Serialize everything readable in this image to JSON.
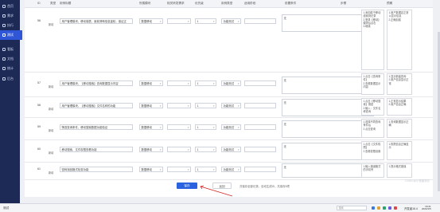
{
  "sidebar": {
    "items": [
      {
        "label": "首页",
        "icon": "home-icon",
        "active": false
      },
      {
        "label": "需求",
        "icon": "doc-icon",
        "active": false
      },
      {
        "label": "执行",
        "icon": "run-icon",
        "active": false
      },
      {
        "label": "测试",
        "icon": "test-icon",
        "active": true
      },
      {
        "label": "看板",
        "icon": "board-icon",
        "active": false
      },
      {
        "label": "文档",
        "icon": "file-icon",
        "active": false
      },
      {
        "label": "统计",
        "icon": "chart-icon",
        "active": false
      },
      {
        "label": "后台",
        "icon": "settings-icon",
        "active": false
      }
    ]
  },
  "table": {
    "headers": [
      "ID",
      "类型",
      "用例标题",
      "所属模块",
      "相关研发需求",
      "优先级",
      "用例类型",
      "适用阶段",
      "前置条件",
      "步骤",
      "预期"
    ],
    "rows": [
      {
        "id": "56",
        "status": "新增",
        "title": "用户管理模块，移动端表，面前清晰信息量较，保证正",
        "module": "数据移动",
        "priority": "1",
        "case_type": "功能测试",
        "stage": "",
        "pre": "无",
        "steps": [
          {
            "n": "1.",
            "text": "添加若干移动线索到记录"
          },
          {
            "n": "2.",
            "text": "登录【移动】模块后点击"
          },
          {
            "n": "3.",
            "text": "继续"
          }
        ],
        "expect": [
          {
            "n": "1.",
            "text": "用户数据定正常以显示信息"
          },
          {
            "n": "2.",
            "text": "正确加载"
          }
        ]
      },
      {
        "id": "57",
        "status": "新增",
        "title": "用户管理模块，【移动搜索】查询数据显示内容",
        "module": "数据移动",
        "priority": "1",
        "case_type": "功能测试",
        "stage": "",
        "pre": "无",
        "steps": [
          {
            "n": "1.",
            "text": "点击【查询条件】"
          },
          {
            "n": "2.",
            "text": "查看数据显示内容"
          }
        ],
        "expect": [
          {
            "n": "1.",
            "text": "显示新建查询"
          },
          {
            "n": "2.",
            "text": "用户信息显示正常"
          }
        ]
      },
      {
        "id": "58",
        "status": "新增",
        "title": "用户管理模块，【移动搜索】文件名称的功能",
        "module": "数据移动",
        "priority": "1",
        "case_type": "功能测试",
        "stage": "",
        "pre": "无",
        "steps": [
          {
            "n": "1.",
            "text": "点击【移动搜索】按钮"
          },
          {
            "n": "2.",
            "text": "输入：文件名称查询"
          }
        ],
        "expect": [
          {
            "n": "1.",
            "text": "正常显示结果"
          },
          {
            "n": "2.",
            "text": "用户信息正确"
          }
        ]
      },
      {
        "id": "59",
        "status": "新增",
        "title": "筛选查询条件，移动搜索数据功能验证",
        "module": "数据移动",
        "priority": "1",
        "case_type": "功能测试",
        "stage": "",
        "pre": "无",
        "steps": [
          {
            "n": "1.",
            "text": "选择不同查询条件后"
          },
          {
            "n": "2.",
            "text": "点击查询"
          }
        ],
        "expect": [
          {
            "n": "1.",
            "text": "查询数据显示正确"
          }
        ]
      },
      {
        "id": "60",
        "status": "新增",
        "title": "移动搜索，文件权限查看功能",
        "module": "数据移动",
        "priority": "1",
        "case_type": "功能测试",
        "stage": "",
        "pre": "无",
        "steps": [
          {
            "n": "1.",
            "text": "点击【文件权限】"
          },
          {
            "n": "2.",
            "text": "查看权限设置"
          }
        ],
        "expect": [
          {
            "n": "1.",
            "text": "权限信息正确显示"
          }
        ]
      },
      {
        "id": "61",
        "status": "新增",
        "title": "密码找回格式检查功能",
        "module": "数据移动",
        "priority": "1",
        "case_type": "功能测试",
        "stage": "",
        "pre": "无",
        "steps": [
          {
            "n": "1.",
            "text": "输入错误格式的手机号"
          }
        ],
        "expect": [
          {
            "n": "1.",
            "text": "提示格式错误"
          }
        ]
      }
    ]
  },
  "footer": {
    "save_label": "保存",
    "back_label": "返回",
    "hint": "共保存全部记录，自动生成ID，共保存5项"
  },
  "watermark": "CSDN @小怪兽测试",
  "taskbar": {
    "start_label": "测试",
    "search_placeholder": "搜索",
    "app_label": "开发者16.4",
    "time": "16:21",
    "date": "2023/1/5"
  }
}
